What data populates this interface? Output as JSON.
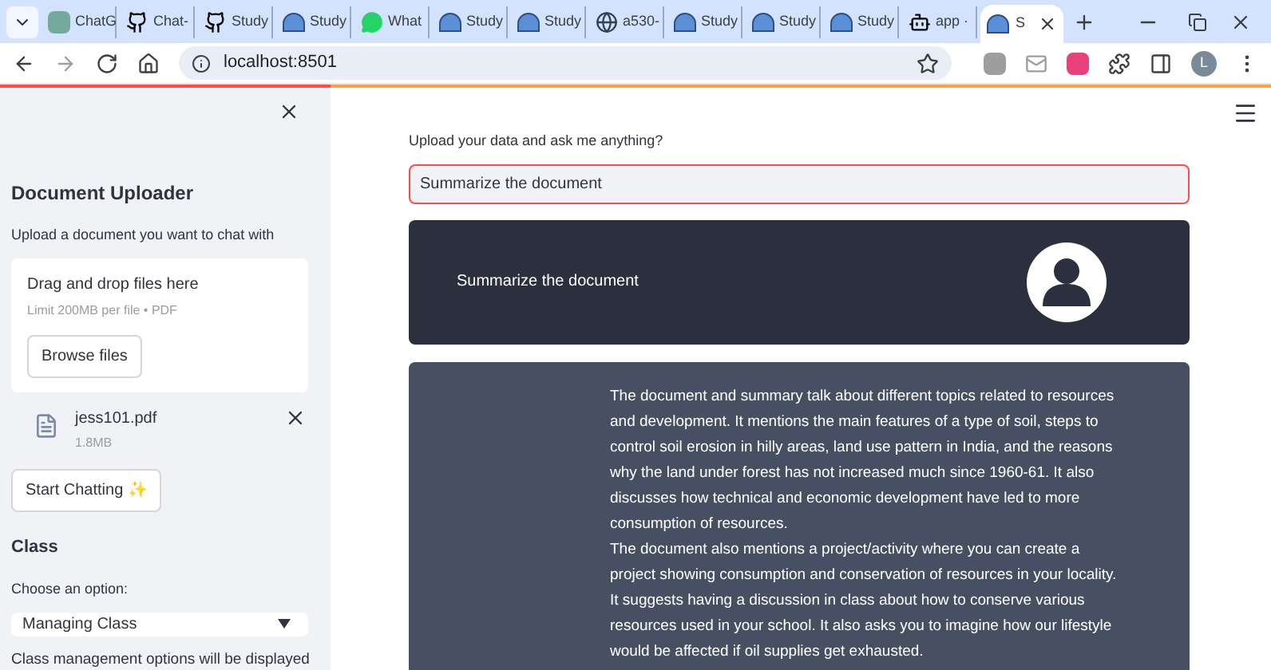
{
  "browser": {
    "tabs": [
      {
        "label": "ChatG",
        "kind": "chatgpt",
        "selected": false
      },
      {
        "label": "Chat-",
        "kind": "github",
        "selected": false
      },
      {
        "label": "Study",
        "kind": "github",
        "selected": false
      },
      {
        "label": "Study",
        "kind": "streamlit",
        "selected": false
      },
      {
        "label": "What",
        "kind": "whatsapp",
        "selected": false
      },
      {
        "label": "Study",
        "kind": "streamlit",
        "selected": false
      },
      {
        "label": "Study",
        "kind": "streamlit",
        "selected": false
      },
      {
        "label": "a530-",
        "kind": "globe",
        "selected": false
      },
      {
        "label": "Study",
        "kind": "streamlit",
        "selected": false
      },
      {
        "label": "Study",
        "kind": "streamlit",
        "selected": false
      },
      {
        "label": "Study",
        "kind": "streamlit",
        "selected": false
      },
      {
        "label": "app ·",
        "kind": "app",
        "selected": false
      },
      {
        "label": "S",
        "kind": "streamlit",
        "selected": true
      }
    ],
    "address": "localhost:8501",
    "profile_initial": "L"
  },
  "sidebar": {
    "title": "Document Uploader",
    "upload_label": "Upload a document you want to chat with",
    "dropzone": {
      "title": "Drag and drop files here",
      "hint": "Limit 200MB per file • PDF",
      "button": "Browse files"
    },
    "file": {
      "name": "jess101.pdf",
      "size": "1.8MB"
    },
    "start_button": "Start Chatting ✨",
    "section_title": "Class",
    "select_label": "Choose an option:",
    "select_value": "Managing Class",
    "note": "Class management options will be displayed"
  },
  "main": {
    "prompt_label": "Upload your data and ask me anything?",
    "prompt_value": "Summarize the document",
    "messages": [
      {
        "kind": "user",
        "text": "Summarize the document"
      },
      {
        "kind": "assistant",
        "paragraphs": [
          "The document and summary talk about different topics related to resources and development. It mentions the main features of a type of soil, steps to control soil erosion in hilly areas, land use pattern in India, and the reasons why the land under forest has not increased much since 1960-61. It also discusses how technical and economic development have led to more consumption of resources.",
          "The document also mentions a project/activity where you can create a project showing consumption and conservation of resources in your locality. It suggests having a discussion in class about how to conserve various resources used in your school. It also asks you to imagine how our lifestyle would be affected if oil supplies get exhausted."
        ]
      }
    ]
  }
}
